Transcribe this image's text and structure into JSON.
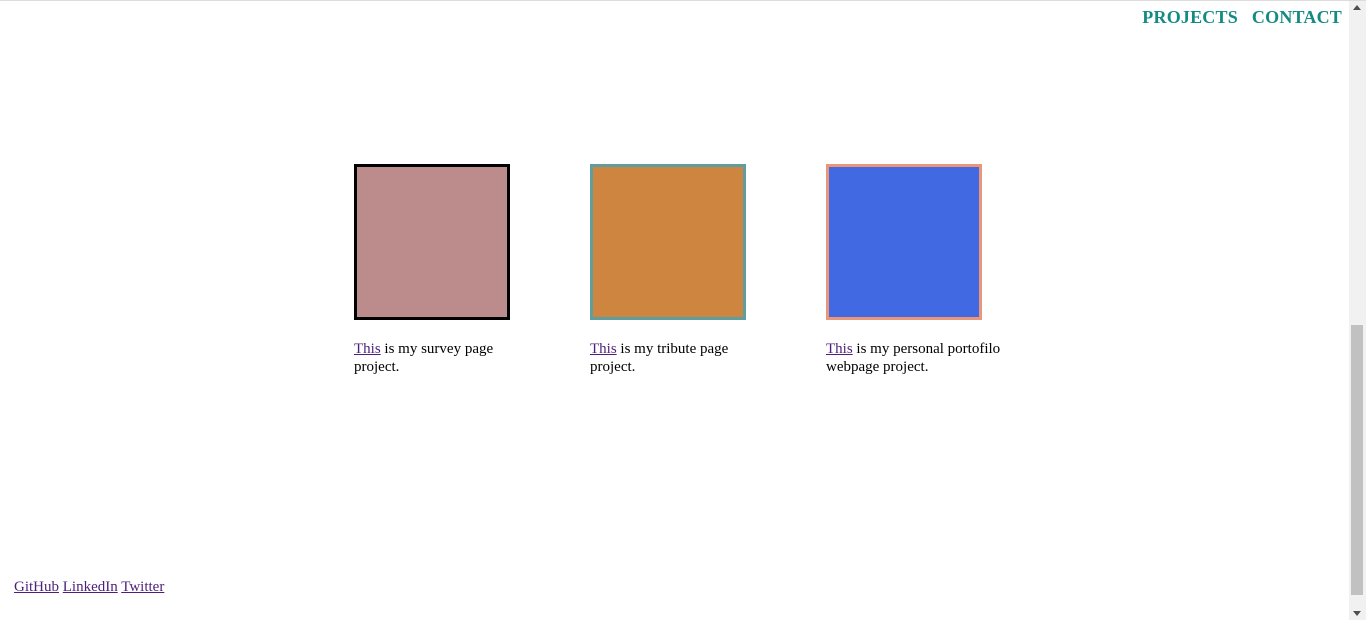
{
  "nav": {
    "projects_label": "PROJECTS",
    "contact_label": "CONTACT",
    "color": "#138a82"
  },
  "projects": [
    {
      "link_text": "This",
      "description": " is my survey page project.",
      "fill_color": "#bb8c8b",
      "border_color": "#000000"
    },
    {
      "link_text": "This",
      "description": " is my tribute page project.",
      "fill_color": "#cd853f",
      "border_color": "#5f9ea0"
    },
    {
      "link_text": "This",
      "description": " is my personal portofilo webpage project.",
      "fill_color": "#4169e1",
      "border_color": "#e9967a"
    }
  ],
  "footer": {
    "github_label": "GitHub",
    "linkedin_label": "LinkedIn",
    "twitter_label": "Twitter"
  }
}
